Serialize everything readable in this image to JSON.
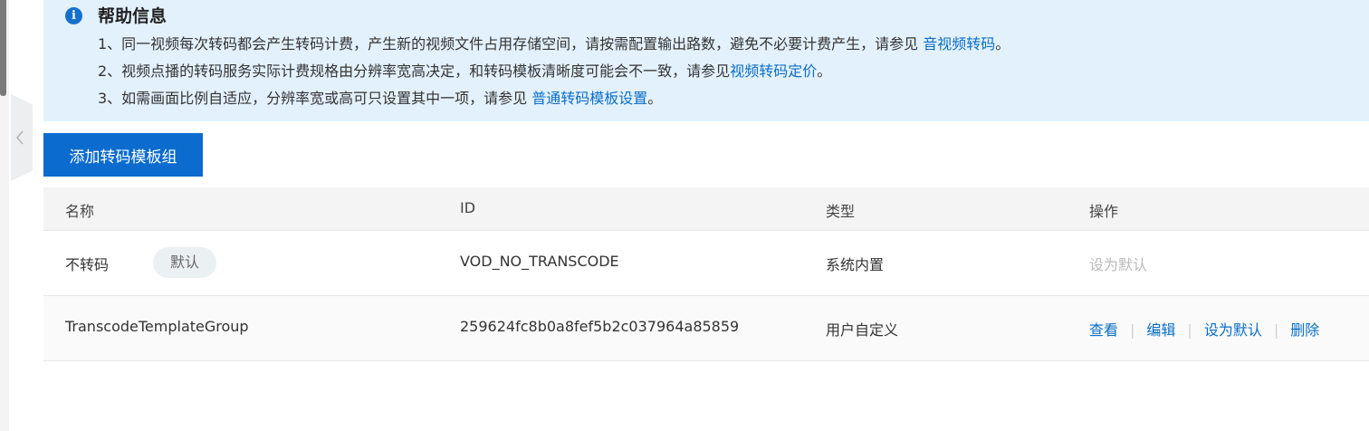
{
  "help": {
    "title": "帮助信息",
    "icon": "info-icon",
    "lines": [
      {
        "text": "1、同一视频每次转码都会产生转码计费，产生新的视频文件占用存储空间，请按需配置输出路数，避免不必要计费产生，请参见 ",
        "link": "音视频转码",
        "end": "。"
      },
      {
        "text": "2、视频点播的转码服务实际计费规格由分辨率宽高决定，和转码模板清晰度可能会不一致，请参见",
        "link": "视频转码定价",
        "end": "。"
      },
      {
        "text": "3、如需画面比例自适应，分辨率宽或高可只设置其中一项，请参见 ",
        "link": "普通转码模板设置",
        "end": "。"
      }
    ]
  },
  "toolbar": {
    "add_label": "添加转码模板组"
  },
  "table": {
    "headers": [
      "名称",
      "ID",
      "类型",
      "操作"
    ],
    "rows": [
      {
        "name": "不转码",
        "badge": "默认",
        "id": "VOD_NO_TRANSCODE",
        "type": "系统内置",
        "actions": [
          "设为默认"
        ]
      },
      {
        "name": "TranscodeTemplateGroup",
        "id": "259624fc8b0a8fef5b2c037964a85859",
        "type": "用户自定义",
        "actions": [
          "查看",
          "编辑",
          "设为默认",
          "删除"
        ]
      }
    ]
  },
  "colors": {
    "accent": "#0b6bcf",
    "help_bg": "#e3f1fd",
    "link": "#0a6ec7"
  }
}
